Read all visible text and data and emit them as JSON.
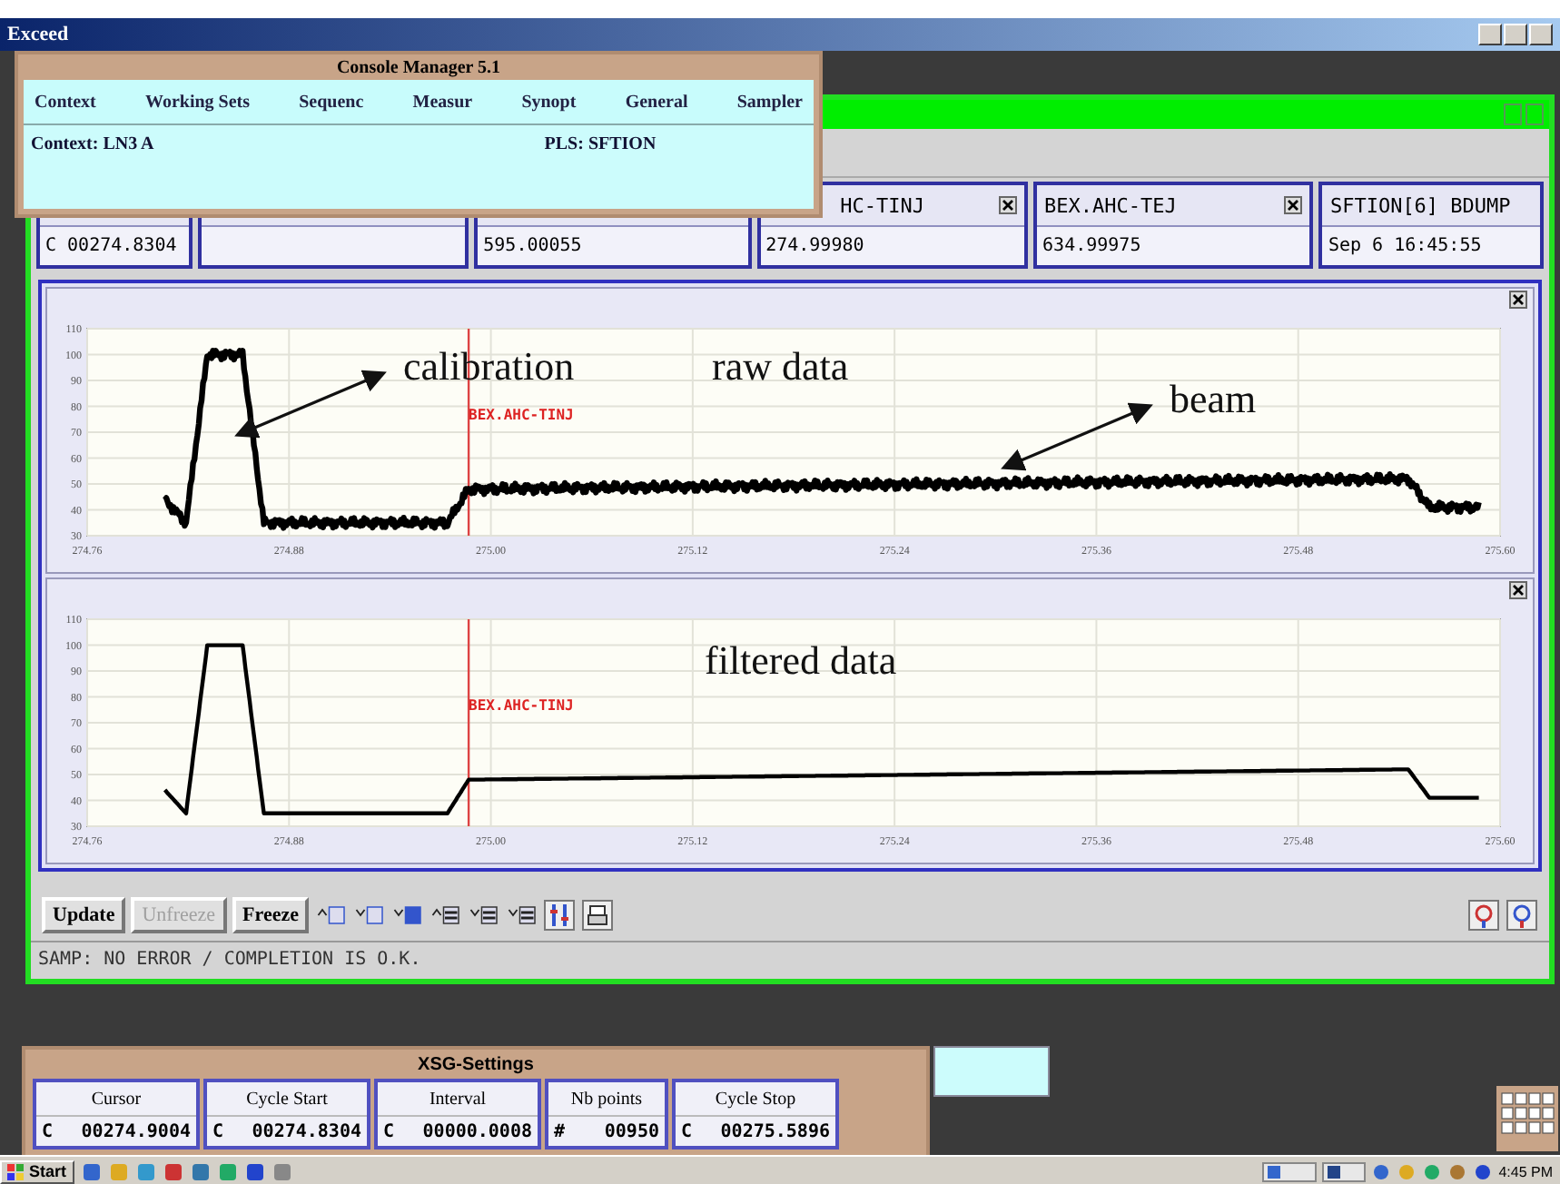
{
  "app_bar": {
    "title": "Exceed"
  },
  "console_manager": {
    "title": "Console Manager 5.1",
    "menu": [
      "Context",
      "Working Sets",
      "Sequenc",
      "Measur",
      "Synopt",
      "General",
      "Sampler"
    ],
    "context": "Context: LN3 A",
    "pls": "PLS: SFTION"
  },
  "readouts": [
    {
      "kind": "value",
      "value": "C 00274.8304"
    },
    {
      "kind": "blank"
    },
    {
      "kind": "value",
      "value": "595.00055"
    },
    {
      "kind": "value",
      "header": "HC-TINJ",
      "value": "274.99980"
    },
    {
      "kind": "value",
      "header": "BEX.AHC-TEJ",
      "value": "634.99975"
    },
    {
      "kind": "value",
      "header": "SFTION[6] BDUMP",
      "value": "Sep  6 16:45:55"
    }
  ],
  "charts": [
    {
      "kind": "raw",
      "y_ticks": [
        "110",
        "100",
        "90",
        "80",
        "70",
        "60",
        "50",
        "40",
        "30"
      ],
      "x_ticks": [
        "274.76",
        "274.88",
        "275.00",
        "275.12",
        "275.24",
        "275.36",
        "275.48",
        "275.60"
      ],
      "marker_label": "BEX.AHC-TINJ",
      "annotations": [
        {
          "text": "calibration",
          "arrow": true
        },
        {
          "text": "raw data",
          "arrow": false
        },
        {
          "text": "beam",
          "arrow": true
        }
      ]
    },
    {
      "kind": "filtered",
      "y_ticks": [
        "110",
        "100",
        "90",
        "80",
        "70",
        "60",
        "50",
        "40",
        "30"
      ],
      "x_ticks": [
        "274.76",
        "274.88",
        "275.00",
        "275.12",
        "275.24",
        "275.36",
        "275.48",
        "275.60"
      ],
      "marker_label": "BEX.AHC-TINJ",
      "annotations": [
        {
          "text": "filtered data",
          "arrow": false
        }
      ]
    }
  ],
  "toolbar": {
    "buttons": [
      {
        "label": "Update",
        "disabled": false
      },
      {
        "label": "Unfreeze",
        "disabled": true
      },
      {
        "label": "Freeze",
        "disabled": false
      }
    ]
  },
  "status": "SAMP: NO ERROR  / COMPLETION IS O.K.",
  "xsg_settings": {
    "title": "XSG-Settings",
    "fields": [
      {
        "label": "Cursor",
        "prefix": "C",
        "value": "00274.9004"
      },
      {
        "label": "Cycle Start",
        "prefix": "C",
        "value": "00274.8304"
      },
      {
        "label": "Interval",
        "prefix": "C",
        "value": "00000.0008"
      },
      {
        "label": "Nb points",
        "prefix": "#",
        "value": "00950"
      },
      {
        "label": "Cycle Stop",
        "prefix": "C",
        "value": "00275.5896"
      }
    ]
  },
  "taskbar": {
    "start": "Start",
    "clock": "4:45 PM"
  }
}
